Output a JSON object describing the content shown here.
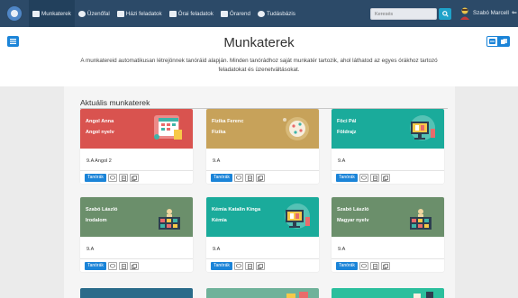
{
  "navbar": {
    "items": [
      {
        "label": "Munkaterek",
        "active": true
      },
      {
        "label": "Üzenőfal"
      },
      {
        "label": "Házi feladatok"
      },
      {
        "label": "Órai feladatok"
      },
      {
        "label": "Órarend"
      },
      {
        "label": "Tudásbázis"
      }
    ],
    "search_placeholder": "Keresés",
    "user_name": "Szabó Marcell"
  },
  "header": {
    "title": "Munkaterek",
    "description": "A munkatereid automatikusan létrejönnek tanóráid alapján. Minden tanórádhoz saját munkatér tartozik, ahol láthatod az egyes órákhoz tartozó feladatokat és üzenetváltásokat."
  },
  "section": {
    "title": "Aktuális munkaterek"
  },
  "cards": [
    {
      "teacher": "Angol Anna",
      "subject": "Angol nyelv",
      "class": "9.A Angol 2",
      "button": "Tanórák",
      "color": "#d9534f",
      "illustration": "calendar-illustration"
    },
    {
      "teacher": "Fizika Ferenc",
      "subject": "Fizika",
      "class": "9.A",
      "button": "Tanórák",
      "color": "#c7a25a",
      "illustration": "pie-chart-illustration"
    },
    {
      "teacher": "Föci Pál",
      "subject": "Földrajz",
      "class": "9.A",
      "button": "Tanórák",
      "color": "#1aab9b",
      "illustration": "monitor-illustration"
    },
    {
      "teacher": "Szabó László",
      "subject": "Irodalom",
      "class": "9.A",
      "button": "Tanórák",
      "color": "#6b8f6b",
      "illustration": "building-illustration"
    },
    {
      "teacher": "Kémia Katalin Kinga",
      "subject": "Kémia",
      "class": "9.A",
      "button": "Tanórák",
      "color": "#1aab9b",
      "illustration": "monitor-illustration"
    },
    {
      "teacher": "Szabó László",
      "subject": "Magyar nyelv",
      "class": "9.A",
      "button": "Tanórák",
      "color": "#6b8f6b",
      "illustration": "building-illustration"
    }
  ],
  "partial_cards": [
    {
      "color": "#2a6b8a"
    },
    {
      "color": "#6fb29a"
    },
    {
      "color": "#2bbf9d"
    }
  ]
}
